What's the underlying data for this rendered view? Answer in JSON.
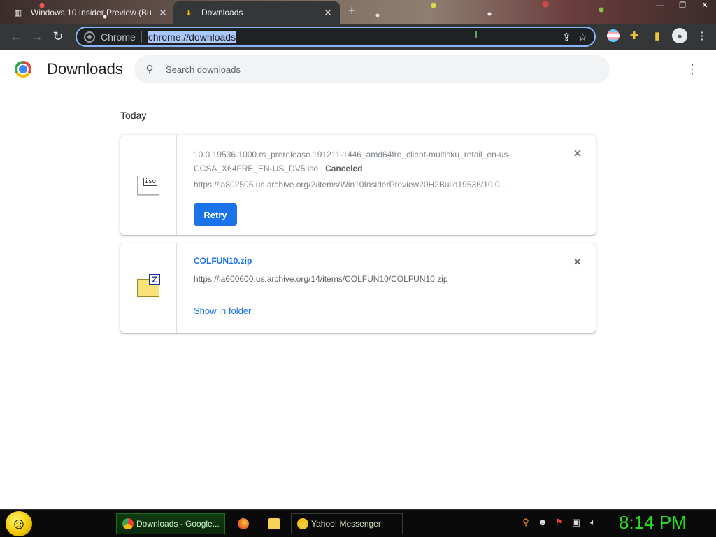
{
  "browser": {
    "tabs": [
      {
        "title": "Windows 10 Insider Preview (Bu",
        "active": false
      },
      {
        "title": "Downloads",
        "active": true
      }
    ],
    "new_tab": "+",
    "window_controls": [
      "—",
      "❐",
      "✕"
    ],
    "omnibox": {
      "chip_label": "Chrome",
      "url": "chrome://downloads"
    }
  },
  "page": {
    "title": "Downloads",
    "search_placeholder": "Search downloads",
    "date_group": "Today",
    "downloads": [
      {
        "file_name": "10.0.19536.1000.rs_prerelease.191211-1446_amd64fre_client-multisku_retail_en-us-CCSA_X64FRE_EN-US_DV5.iso",
        "status": "Canceled",
        "url": "https://ia802505.us.archive.org/2/items/Win10InsiderPreview20H2Build19536/10.0....",
        "action": "Retry",
        "icon": "iso-file-icon",
        "icon_label": "iso"
      },
      {
        "file_name": "COLFUN10.zip",
        "url": "https://ia600600.us.archive.org/14/items/COLFUN10/COLFUN10.zip",
        "action": "Show in folder",
        "icon": "zip-file-icon",
        "icon_label": "Z"
      }
    ]
  },
  "taskbar": {
    "items": [
      {
        "label": "Downloads - Google...",
        "icon": "chrome-icon"
      },
      {
        "label": "",
        "icon": "firefox-icon"
      },
      {
        "label": "",
        "icon": "folder-icon"
      },
      {
        "label": "Yahoo! Messenger",
        "icon": "yahoo-icon"
      }
    ],
    "clock": "8:14 PM"
  },
  "colors": {
    "accent": "#1a73e8",
    "toolbar": "#353637",
    "omnibox_border": "#8ab4f8",
    "clock": "#22dd22"
  }
}
